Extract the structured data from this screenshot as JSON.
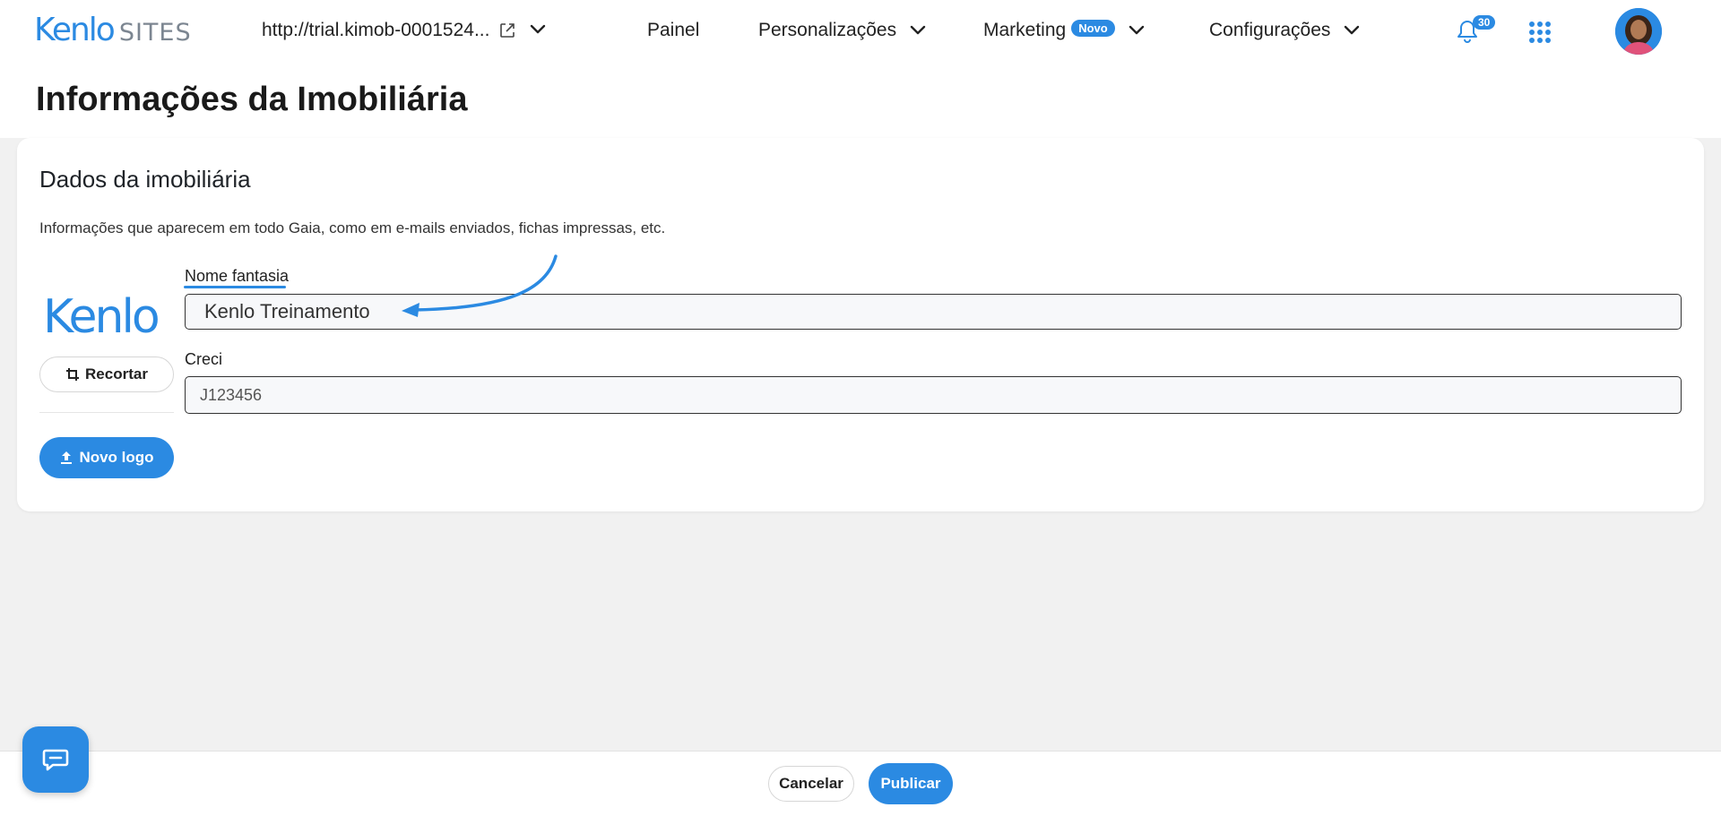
{
  "header": {
    "brand_name": "Kenlo",
    "brand_suffix": "SITES",
    "site_url": "http://trial.kimob-0001524...",
    "nav": [
      {
        "label": "Painel"
      },
      {
        "label": "Personalizações"
      },
      {
        "label": "Marketing",
        "badge": "Novo"
      },
      {
        "label": "Configurações"
      }
    ],
    "notifications_count": "30",
    "icons": [
      "external-link-icon",
      "chevron-down-icon",
      "bell-icon",
      "apps-grid-icon",
      "avatar"
    ]
  },
  "page": {
    "title": "Informações da Imobiliária"
  },
  "card": {
    "title": "Dados da imobiliária",
    "description": "Informações que aparecem em todo Gaia, como em e-mails enviados, fichas impressas, etc.",
    "logo_text": "Kenlo",
    "crop_button": "Recortar",
    "new_logo_button": "Novo logo",
    "fields": {
      "nome_fantasia_label": "Nome fantasia",
      "nome_fantasia_value": "Kenlo Treinamento",
      "creci_label": "Creci",
      "creci_value": "J123456"
    }
  },
  "footer": {
    "cancel_label": "Cancelar",
    "publish_label": "Publicar"
  },
  "colors": {
    "accent": "#2b8ae2",
    "background": "#f1f1f1",
    "card": "#ffffff"
  }
}
